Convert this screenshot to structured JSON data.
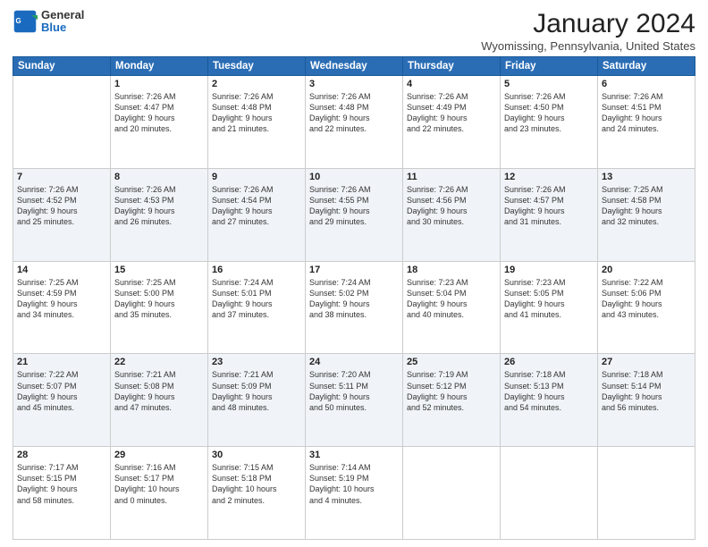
{
  "header": {
    "logo_general": "General",
    "logo_blue": "Blue",
    "month_title": "January 2024",
    "location": "Wyomissing, Pennsylvania, United States"
  },
  "days_of_week": [
    "Sunday",
    "Monday",
    "Tuesday",
    "Wednesday",
    "Thursday",
    "Friday",
    "Saturday"
  ],
  "weeks": [
    [
      {
        "day": "",
        "content": ""
      },
      {
        "day": "1",
        "content": "Sunrise: 7:26 AM\nSunset: 4:47 PM\nDaylight: 9 hours\nand 20 minutes."
      },
      {
        "day": "2",
        "content": "Sunrise: 7:26 AM\nSunset: 4:48 PM\nDaylight: 9 hours\nand 21 minutes."
      },
      {
        "day": "3",
        "content": "Sunrise: 7:26 AM\nSunset: 4:48 PM\nDaylight: 9 hours\nand 22 minutes."
      },
      {
        "day": "4",
        "content": "Sunrise: 7:26 AM\nSunset: 4:49 PM\nDaylight: 9 hours\nand 22 minutes."
      },
      {
        "day": "5",
        "content": "Sunrise: 7:26 AM\nSunset: 4:50 PM\nDaylight: 9 hours\nand 23 minutes."
      },
      {
        "day": "6",
        "content": "Sunrise: 7:26 AM\nSunset: 4:51 PM\nDaylight: 9 hours\nand 24 minutes."
      }
    ],
    [
      {
        "day": "7",
        "content": "Sunrise: 7:26 AM\nSunset: 4:52 PM\nDaylight: 9 hours\nand 25 minutes."
      },
      {
        "day": "8",
        "content": "Sunrise: 7:26 AM\nSunset: 4:53 PM\nDaylight: 9 hours\nand 26 minutes."
      },
      {
        "day": "9",
        "content": "Sunrise: 7:26 AM\nSunset: 4:54 PM\nDaylight: 9 hours\nand 27 minutes."
      },
      {
        "day": "10",
        "content": "Sunrise: 7:26 AM\nSunset: 4:55 PM\nDaylight: 9 hours\nand 29 minutes."
      },
      {
        "day": "11",
        "content": "Sunrise: 7:26 AM\nSunset: 4:56 PM\nDaylight: 9 hours\nand 30 minutes."
      },
      {
        "day": "12",
        "content": "Sunrise: 7:26 AM\nSunset: 4:57 PM\nDaylight: 9 hours\nand 31 minutes."
      },
      {
        "day": "13",
        "content": "Sunrise: 7:25 AM\nSunset: 4:58 PM\nDaylight: 9 hours\nand 32 minutes."
      }
    ],
    [
      {
        "day": "14",
        "content": "Sunrise: 7:25 AM\nSunset: 4:59 PM\nDaylight: 9 hours\nand 34 minutes."
      },
      {
        "day": "15",
        "content": "Sunrise: 7:25 AM\nSunset: 5:00 PM\nDaylight: 9 hours\nand 35 minutes."
      },
      {
        "day": "16",
        "content": "Sunrise: 7:24 AM\nSunset: 5:01 PM\nDaylight: 9 hours\nand 37 minutes."
      },
      {
        "day": "17",
        "content": "Sunrise: 7:24 AM\nSunset: 5:02 PM\nDaylight: 9 hours\nand 38 minutes."
      },
      {
        "day": "18",
        "content": "Sunrise: 7:23 AM\nSunset: 5:04 PM\nDaylight: 9 hours\nand 40 minutes."
      },
      {
        "day": "19",
        "content": "Sunrise: 7:23 AM\nSunset: 5:05 PM\nDaylight: 9 hours\nand 41 minutes."
      },
      {
        "day": "20",
        "content": "Sunrise: 7:22 AM\nSunset: 5:06 PM\nDaylight: 9 hours\nand 43 minutes."
      }
    ],
    [
      {
        "day": "21",
        "content": "Sunrise: 7:22 AM\nSunset: 5:07 PM\nDaylight: 9 hours\nand 45 minutes."
      },
      {
        "day": "22",
        "content": "Sunrise: 7:21 AM\nSunset: 5:08 PM\nDaylight: 9 hours\nand 47 minutes."
      },
      {
        "day": "23",
        "content": "Sunrise: 7:21 AM\nSunset: 5:09 PM\nDaylight: 9 hours\nand 48 minutes."
      },
      {
        "day": "24",
        "content": "Sunrise: 7:20 AM\nSunset: 5:11 PM\nDaylight: 9 hours\nand 50 minutes."
      },
      {
        "day": "25",
        "content": "Sunrise: 7:19 AM\nSunset: 5:12 PM\nDaylight: 9 hours\nand 52 minutes."
      },
      {
        "day": "26",
        "content": "Sunrise: 7:18 AM\nSunset: 5:13 PM\nDaylight: 9 hours\nand 54 minutes."
      },
      {
        "day": "27",
        "content": "Sunrise: 7:18 AM\nSunset: 5:14 PM\nDaylight: 9 hours\nand 56 minutes."
      }
    ],
    [
      {
        "day": "28",
        "content": "Sunrise: 7:17 AM\nSunset: 5:15 PM\nDaylight: 9 hours\nand 58 minutes."
      },
      {
        "day": "29",
        "content": "Sunrise: 7:16 AM\nSunset: 5:17 PM\nDaylight: 10 hours\nand 0 minutes."
      },
      {
        "day": "30",
        "content": "Sunrise: 7:15 AM\nSunset: 5:18 PM\nDaylight: 10 hours\nand 2 minutes."
      },
      {
        "day": "31",
        "content": "Sunrise: 7:14 AM\nSunset: 5:19 PM\nDaylight: 10 hours\nand 4 minutes."
      },
      {
        "day": "",
        "content": ""
      },
      {
        "day": "",
        "content": ""
      },
      {
        "day": "",
        "content": ""
      }
    ]
  ]
}
